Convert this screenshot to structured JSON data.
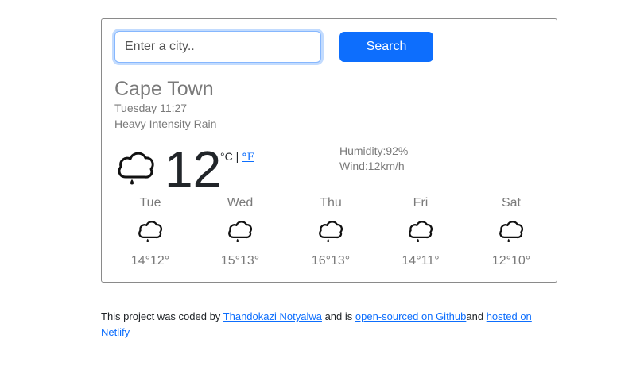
{
  "search": {
    "placeholder": "Enter a city..",
    "value": "",
    "button_label": "Search"
  },
  "weather": {
    "city": "Cape Town",
    "datetime": "Tuesday 11:27",
    "description": "Heavy Intensity Rain",
    "icon": "rain-cloud-icon",
    "temperature": "12",
    "unit_celsius": "°C",
    "unit_separator": "|",
    "unit_fahrenheit": "°F",
    "humidity": "Humidity:92%",
    "wind": "Wind:12km/h"
  },
  "forecast": [
    {
      "day": "Tue",
      "temps": "14°12°",
      "icon": "rain-cloud-icon"
    },
    {
      "day": "Wed",
      "temps": "15°13°",
      "icon": "rain-cloud-icon"
    },
    {
      "day": "Thu",
      "temps": "16°13°",
      "icon": "rain-cloud-icon"
    },
    {
      "day": "Fri",
      "temps": "14°11°",
      "icon": "rain-cloud-icon"
    },
    {
      "day": "Sat",
      "temps": "12°10°",
      "icon": "rain-cloud-icon"
    }
  ],
  "footer": {
    "text_1": "This project was coded by ",
    "author_link": "Thandokazi Notyalwa",
    "text_2": " and is ",
    "github_link": "open-sourced on Github",
    "text_3": "and ",
    "netlify_link": "hosted on Netlify"
  },
  "colors": {
    "accent": "#0d6efd",
    "muted_text": "#7a7a7a",
    "card_border": "#8a8a8a"
  }
}
